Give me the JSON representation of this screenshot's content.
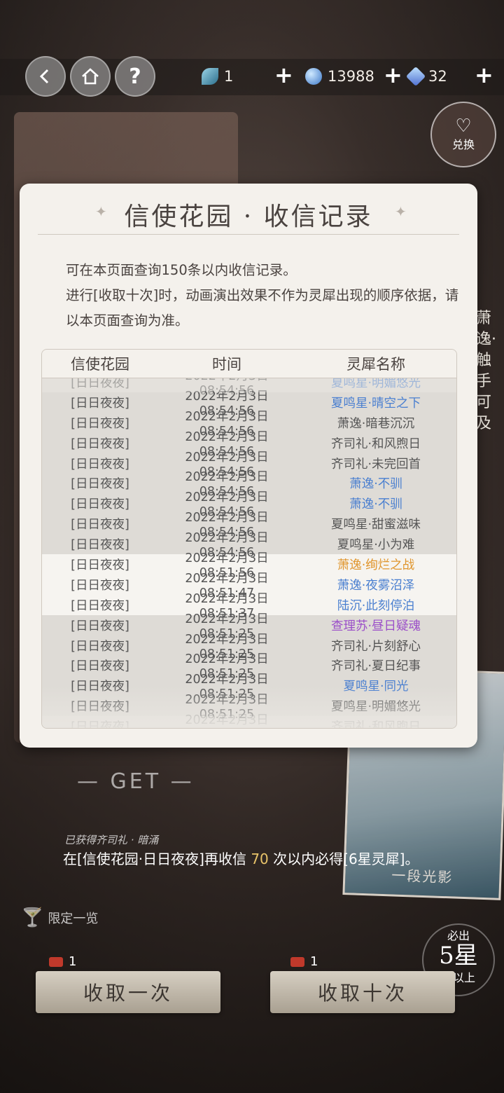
{
  "topbar": {
    "feather_count": "1",
    "crystal_count": "13988",
    "gem_count": "32",
    "help_glyph": "?"
  },
  "exchange": {
    "script": "Exchange",
    "label": "兑换"
  },
  "side_text": "萧逸·触手可及",
  "modal": {
    "title": "信使花园 · 收信记录",
    "intro_line1": "可在本页面查询150条以内收信记录。",
    "intro_line2": "进行[收取十次]时，动画演出效果不作为灵犀出现的顺序依据，请以本页面查询为准。",
    "columns": [
      "信使花园",
      "时间",
      "灵犀名称"
    ],
    "rows": [
      {
        "garden": "[日日夜夜]",
        "time": "2022年2月3日 08:54:56",
        "name": "夏鸣星·明媚悠光",
        "color": "#4a7fd0",
        "zone": "gray",
        "partial": true
      },
      {
        "garden": "[日日夜夜]",
        "time": "2022年2月3日 08:54:56",
        "name": "夏鸣星·晴空之下",
        "color": "#4a7fd0",
        "zone": "gray"
      },
      {
        "garden": "[日日夜夜]",
        "time": "2022年2月3日 08:54:56",
        "name": "萧逸·暗巷沉沉",
        "color": "#555555",
        "zone": "gray"
      },
      {
        "garden": "[日日夜夜]",
        "time": "2022年2月3日 08:54:56",
        "name": "齐司礼·和风煦日",
        "color": "#555555",
        "zone": "gray"
      },
      {
        "garden": "[日日夜夜]",
        "time": "2022年2月3日 08:54:56",
        "name": "齐司礼·未完回首",
        "color": "#555555",
        "zone": "gray"
      },
      {
        "garden": "[日日夜夜]",
        "time": "2022年2月3日 08:54:56",
        "name": "萧逸·不驯",
        "color": "#4a7fd0",
        "zone": "gray"
      },
      {
        "garden": "[日日夜夜]",
        "time": "2022年2月3日 08:54:56",
        "name": "萧逸·不驯",
        "color": "#4a7fd0",
        "zone": "gray"
      },
      {
        "garden": "[日日夜夜]",
        "time": "2022年2月3日 08:54:56",
        "name": "夏鸣星·甜蜜滋味",
        "color": "#555555",
        "zone": "gray"
      },
      {
        "garden": "[日日夜夜]",
        "time": "2022年2月3日 08:54:56",
        "name": "夏鸣星·小为难",
        "color": "#555555",
        "zone": "gray"
      },
      {
        "garden": "[日日夜夜]",
        "time": "2022年2月3日 08:51:56",
        "name": "萧逸·绚烂之战",
        "color": "#e0962e",
        "zone": "white"
      },
      {
        "garden": "[日日夜夜]",
        "time": "2022年2月3日 08:51:47",
        "name": "萧逸·夜雾沼泽",
        "color": "#4a7fd0",
        "zone": "white"
      },
      {
        "garden": "[日日夜夜]",
        "time": "2022年2月3日 08:51:37",
        "name": "陆沉·此刻停泊",
        "color": "#4a7fd0",
        "zone": "white"
      },
      {
        "garden": "[日日夜夜]",
        "time": "2022年2月3日 08:51:25",
        "name": "查理苏·昼日疑魂",
        "color": "#9b4fc9",
        "zone": "gray"
      },
      {
        "garden": "[日日夜夜]",
        "time": "2022年2月3日 08:51:25",
        "name": "齐司礼·片刻舒心",
        "color": "#555555",
        "zone": "gray"
      },
      {
        "garden": "[日日夜夜]",
        "time": "2022年2月3日 08:51:25",
        "name": "齐司礼·夏日纪事",
        "color": "#555555",
        "zone": "gray"
      },
      {
        "garden": "[日日夜夜]",
        "time": "2022年2月3日 08:51:25",
        "name": "夏鸣星·同光",
        "color": "#4a7fd0",
        "zone": "gray"
      },
      {
        "garden": "[日日夜夜]",
        "time": "2022年2月3日 08:51:25",
        "name": "夏鸣星·明媚悠光",
        "color": "#555555",
        "zone": "gray"
      },
      {
        "garden": "[日日夜夜]",
        "time": "2022年2月3日 08:51:25",
        "name": "齐司礼·和风煦日",
        "color": "#555555",
        "zone": "gray",
        "partial": true
      }
    ]
  },
  "background": {
    "get_label": "— GET —",
    "acquired": "已获得齐司礼 · 暗涌",
    "card_caption": "一段光影"
  },
  "pity": {
    "prefix": "在[信使花园·日日夜夜]再收信 ",
    "count": "70",
    "suffix": " 次以内必得[6星灵犀]。"
  },
  "limit_label": "限定一览",
  "guarantee": {
    "top": "必出",
    "mid": "5星",
    "bottom": "或以上"
  },
  "draw_once": {
    "count": "1",
    "label": "收取一次"
  },
  "draw_ten": {
    "count": "1",
    "label": "收取十次"
  }
}
